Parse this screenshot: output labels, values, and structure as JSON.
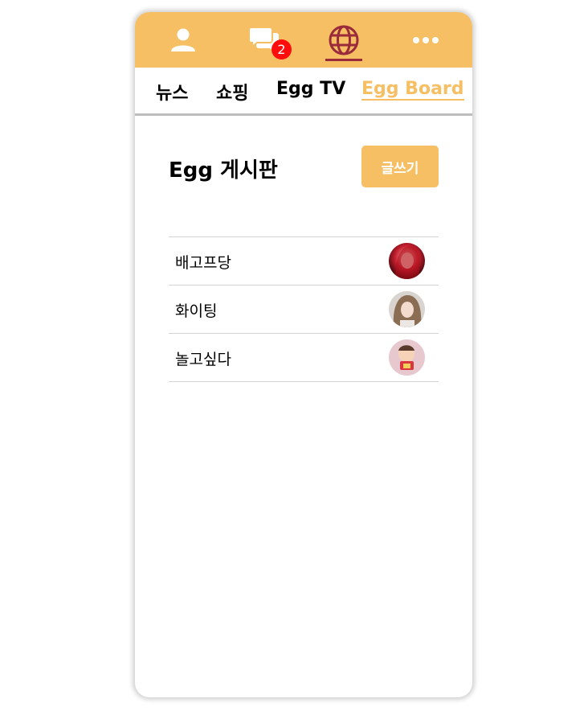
{
  "topbar": {
    "tabs": [
      {
        "icon": "person-icon"
      },
      {
        "icon": "chat-bubbles-icon",
        "badge": "2"
      },
      {
        "icon": "globe-icon",
        "active": true
      },
      {
        "icon": "more-dots-icon"
      }
    ]
  },
  "subnav": {
    "items": [
      {
        "label": "뉴스"
      },
      {
        "label": "쇼핑"
      },
      {
        "label": "Egg TV"
      },
      {
        "label": "Egg Board",
        "active": true
      }
    ]
  },
  "board": {
    "title": "Egg 게시판",
    "write_label": "글쓰기",
    "posts": [
      {
        "title": "배고프당",
        "avatar": "avatar-red-hair"
      },
      {
        "title": "화이팅",
        "avatar": "avatar-blonde"
      },
      {
        "title": "놀고싶다",
        "avatar": "avatar-cartoon"
      }
    ]
  },
  "colors": {
    "accent": "#f6bf63",
    "active_icon": "#9a2b3a",
    "badge": "#ff0d0d"
  }
}
